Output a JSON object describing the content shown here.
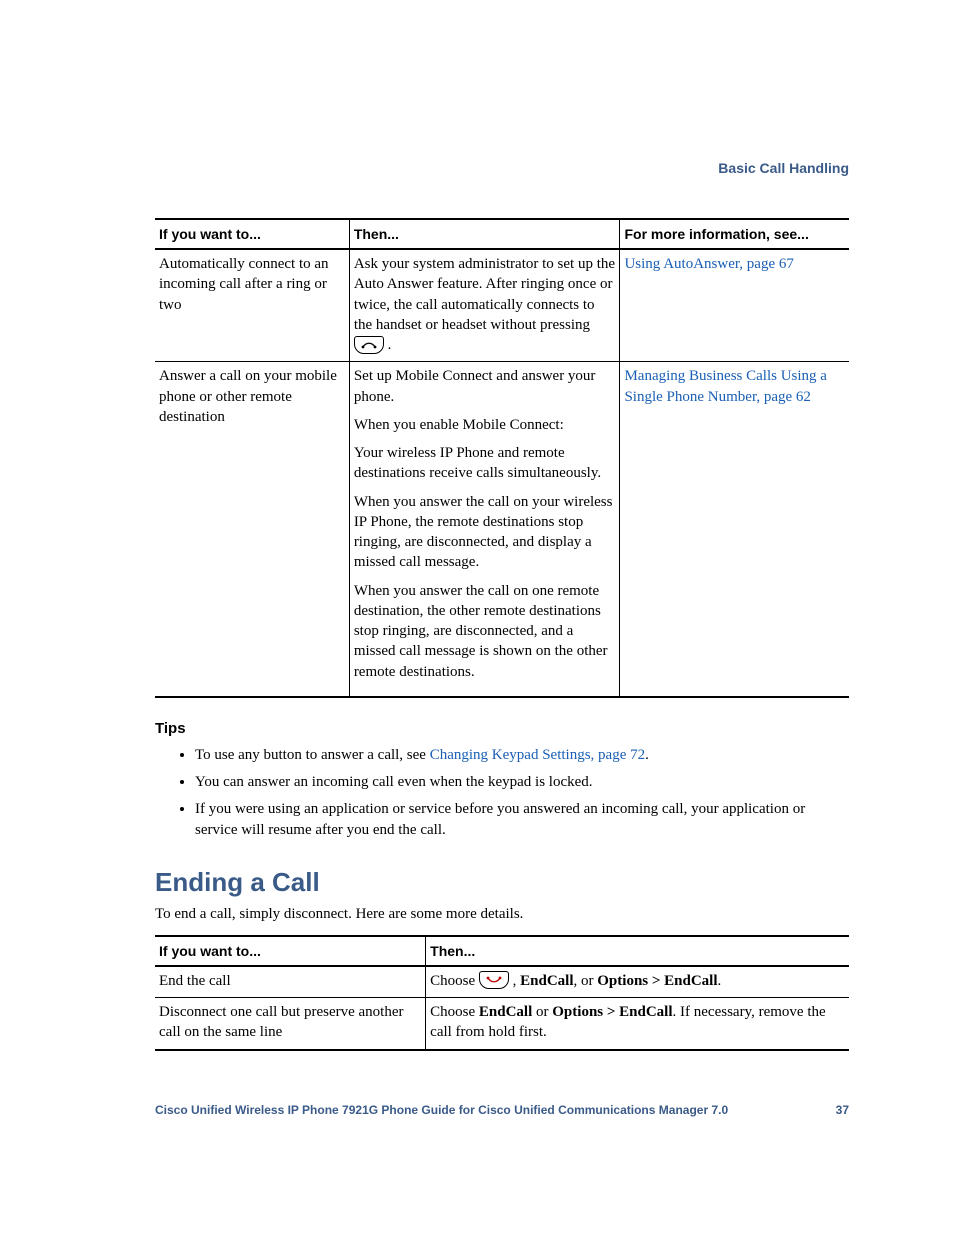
{
  "header": {
    "section": "Basic Call Handling"
  },
  "table1": {
    "headers": {
      "c1": "If you want to...",
      "c2": "Then...",
      "c3": "For more information, see..."
    },
    "rows": [
      {
        "c1": "Automatically connect to an incoming call after a ring or two",
        "c2_text": "Ask your system administrator to set up the Auto Answer feature. After ringing once or twice, the call automatically connects to the handset or headset without pressing ",
        "c2_after": ".",
        "c3_link": "Using AutoAnswer, page 67"
      },
      {
        "c1": "Answer a call on your mobile phone or other remote destination",
        "c2_p1": "Set up Mobile Connect and answer your phone.",
        "c2_p2": "When you enable Mobile Connect:",
        "c2_p3": "Your wireless IP Phone and remote destinations receive calls simultaneously.",
        "c2_p4": "When you answer the call on your wireless IP Phone, the remote destinations stop ringing, are disconnected, and display a missed call message.",
        "c2_p5": "When you answer the call on one remote destination, the other remote destinations stop ringing, are disconnected, and a missed call message is shown on the other remote destinations.",
        "c3_link": "Managing Business Calls Using a Single Phone Number, page 62"
      }
    ]
  },
  "tips": {
    "heading": "Tips",
    "items": {
      "i1_pre": "To use any button to answer a call, see ",
      "i1_link": "Changing Keypad Settings, page 72",
      "i1_post": ".",
      "i2": "You can answer an incoming call even when the keypad is locked.",
      "i3": "If you were using an application or service before you answered an incoming call, your application or service will resume after you end the call."
    }
  },
  "section2": {
    "title": "Ending a Call",
    "intro": "To end a call, simply disconnect. Here are some more details."
  },
  "table2": {
    "headers": {
      "c1": "If you want to...",
      "c2": "Then..."
    },
    "rows": {
      "r1": {
        "c1": "End the call",
        "c2_pre": "Choose ",
        "c2_mid": ", ",
        "c2_b1": "EndCall",
        "c2_mid2": ", or ",
        "c2_b2": "Options > EndCall",
        "c2_post": "."
      },
      "r2": {
        "c1": "Disconnect one call but preserve another call on the same line",
        "c2_pre": "Choose ",
        "c2_b1": "EndCall",
        "c2_mid": " or ",
        "c2_b2": "Options > EndCall",
        "c2_post": ". If necessary, remove the call from hold first."
      }
    }
  },
  "footer": {
    "title": "Cisco Unified Wireless IP Phone 7921G Phone Guide for Cisco Unified Communications Manager 7.0",
    "page": "37"
  }
}
